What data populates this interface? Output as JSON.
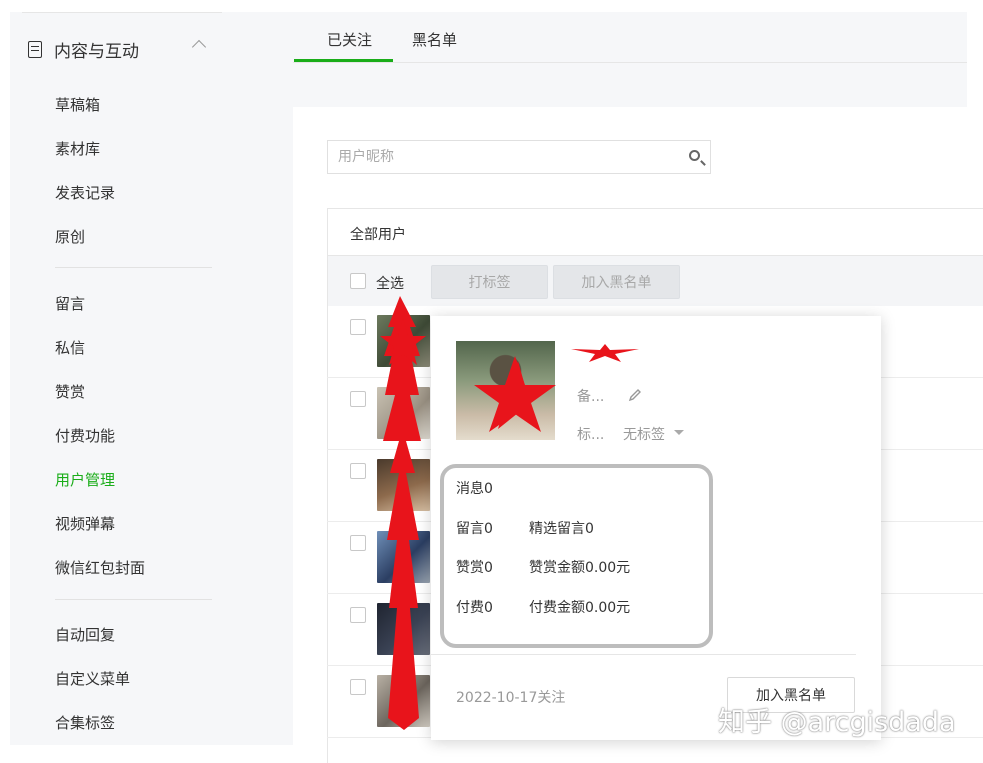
{
  "sidebar": {
    "section_title": "内容与互动",
    "group1": [
      "草稿箱",
      "素材库",
      "发表记录",
      "原创"
    ],
    "group2": [
      "留言",
      "私信",
      "赞赏",
      "付费功能",
      "用户管理",
      "视频弹幕",
      "微信红包封面"
    ],
    "group3": [
      "自动回复",
      "自定义菜单",
      "合集标签"
    ],
    "active_item": "用户管理"
  },
  "tabs": [
    "已关注",
    "黑名单"
  ],
  "search": {
    "placeholder": "用户昵称"
  },
  "table": {
    "header_label": "全部用户",
    "select_all_label": "全选",
    "tag_button": "打标签",
    "blacklist_button": "加入黑名单",
    "row_count": 6
  },
  "popup": {
    "remark_label": "备...",
    "tag_label": "标...",
    "tag_value": "无标签",
    "stats": {
      "messages": "消息0",
      "comments": "留言0",
      "featured_comments": "精选留言0",
      "rewards": "赞赏0",
      "reward_amount": "赞赏金额0.00元",
      "paid": "付费0",
      "paid_amount": "付费金额0.00元"
    },
    "follow_date": "2022-10-17关注",
    "blacklist_button": "加入黑名单"
  },
  "watermark": "知乎 @arcgisdada",
  "colors": {
    "accent_green": "#1aad19",
    "annotation_red": "#e8141b",
    "sidebar_bg": "#f6f7f9"
  }
}
